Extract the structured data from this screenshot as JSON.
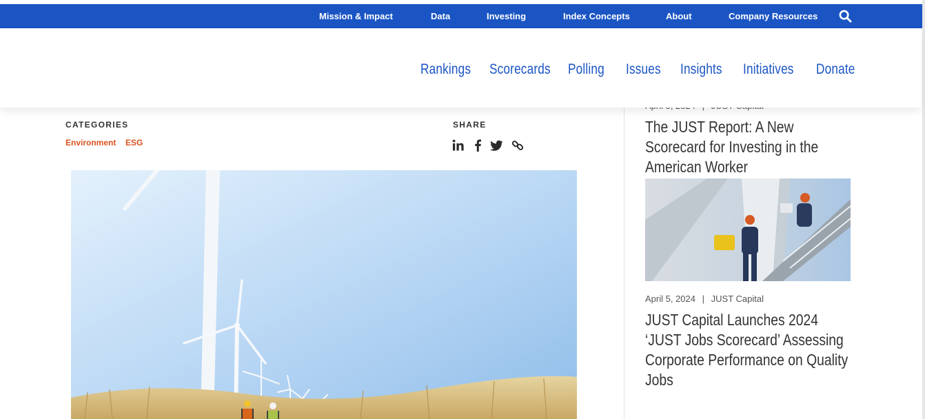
{
  "top_nav": {
    "items": [
      "Mission & Impact",
      "Data",
      "Investing",
      "Index Concepts",
      "About",
      "Company Resources"
    ],
    "search_icon": "search-icon"
  },
  "main_nav": {
    "items": [
      "Rankings",
      "Scorecards",
      "Polling",
      "Issues",
      "Insights",
      "Initiatives",
      "Donate"
    ]
  },
  "article": {
    "categories_label": "CATEGORIES",
    "categories": [
      "Environment",
      "ESG"
    ],
    "share_label": "SHARE",
    "share_icons": [
      "linkedin-icon",
      "facebook-icon",
      "twitter-icon",
      "link-icon"
    ]
  },
  "sidebar": {
    "articles": [
      {
        "date": "April 5, 2024",
        "source": "JUST Capital",
        "title": "The JUST Report: A New Scorecard for Investing in the American Worker"
      },
      {
        "date": "April 5, 2024",
        "source": "JUST Capital",
        "title": "JUST Capital Launches 2024 ‘JUST Jobs Scorecard’ Assessing Corporate Performance on Quality Jobs"
      }
    ]
  },
  "colors": {
    "brand_blue": "#1b55c4",
    "category_orange": "#d9531e",
    "text_dark": "#333333"
  }
}
